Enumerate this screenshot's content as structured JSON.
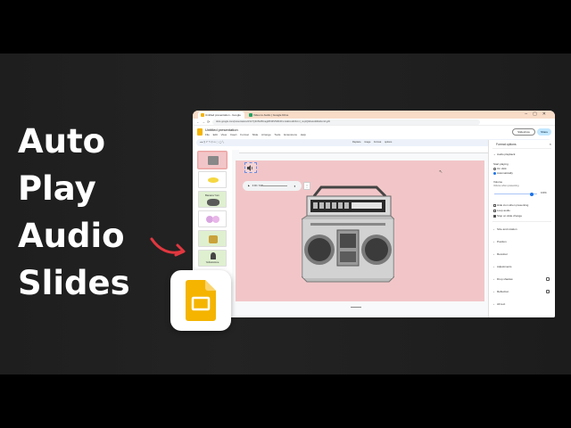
{
  "headline": {
    "lines": [
      "Auto",
      "Play",
      "Audio",
      "Slides"
    ]
  },
  "colors": {
    "accent_arrow": "#e2373f",
    "slide_bg": "#f2c6c8",
    "logo_yellow": "#f4b400"
  },
  "browser": {
    "tabs": [
      {
        "label": "Untitled presentation - Google",
        "icon": "slides-icon"
      },
      {
        "label": "Video to Audio | Google Drive",
        "icon": "drive-icon"
      }
    ],
    "url": "docs.google.com/presentation/d/1z7Q3U5kPRnagR8r0P2W6hFFxmkEGvHbIFcmI_mq1Q9dw/edit#slide=id.g2b",
    "app": {
      "doc_title": "Untitled presentation",
      "menus": "File  Edit  View  Insert  Format  Slide  Arrange  Tools  Extensions  Help",
      "slideshow_label": "Slideshow",
      "share_label": "Share"
    },
    "toolbar": {
      "left": "Format options",
      "right": "Replace image   Format options"
    },
    "filmstrip": [
      {
        "label": "",
        "selected": true
      },
      {
        "label": "",
        "selected": false
      },
      {
        "label": "Banana Yum",
        "selected": false
      },
      {
        "label": "",
        "selected": false
      },
      {
        "label": "",
        "selected": false
      },
      {
        "label": "Yellowstone",
        "selected": false
      }
    ],
    "player": {
      "time": "0:00 / 0:30",
      "play_icon": "play-icon",
      "volume_icon": "volume-icon"
    },
    "side_panel": {
      "title": "Format options",
      "audio_playback": "Audio playback",
      "start_playing": "Start playing",
      "on_click": "On click",
      "automatically": "Automatically",
      "volume_label": "Volume",
      "volume_sub": "Volume when presenting",
      "volume_value": "100%",
      "opts": [
        "Hide icon when presenting",
        "Loop audio",
        "Stop on slide change"
      ],
      "opts_checked": [
        false,
        false,
        true
      ],
      "sections": [
        "Size and rotation",
        "Position",
        "Recolour",
        "Adjustments",
        "Drop shadow",
        "Reflection",
        "Alt text"
      ]
    }
  }
}
